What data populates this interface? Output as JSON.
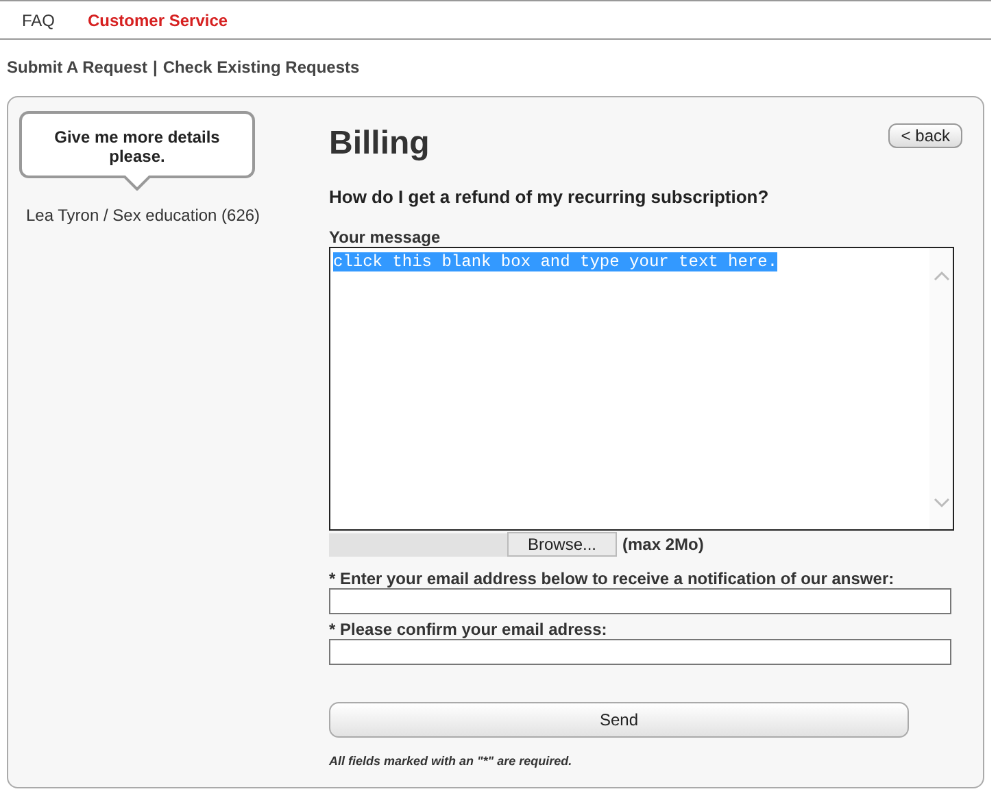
{
  "tabs": [
    {
      "label": "FAQ",
      "selected": false
    },
    {
      "label": "Customer Service",
      "selected": true
    }
  ],
  "subnav": {
    "links": [
      "Submit A Request",
      "Check Existing Requests"
    ],
    "separator": "|"
  },
  "sidebar": {
    "bubble": "Give me more details please.",
    "breadcrumb": "Lea Tyron / Sex education (626)"
  },
  "title": "Billing",
  "back_button": "< back",
  "question": "How do I get a refund of my recurring subscription?",
  "message": {
    "label": "Your message",
    "value": "click this blank box and type your text here.",
    "selected": true
  },
  "attachment": {
    "button": "Browse...",
    "note": "(max 2Mo)"
  },
  "email_fields": [
    {
      "label": "* Enter your email address below to receive a notification of our answer:"
    },
    {
      "label": "* Please confirm your email adress:"
    }
  ],
  "send_button": "Send",
  "footnote": "All fields marked with an \"*\" are required."
}
